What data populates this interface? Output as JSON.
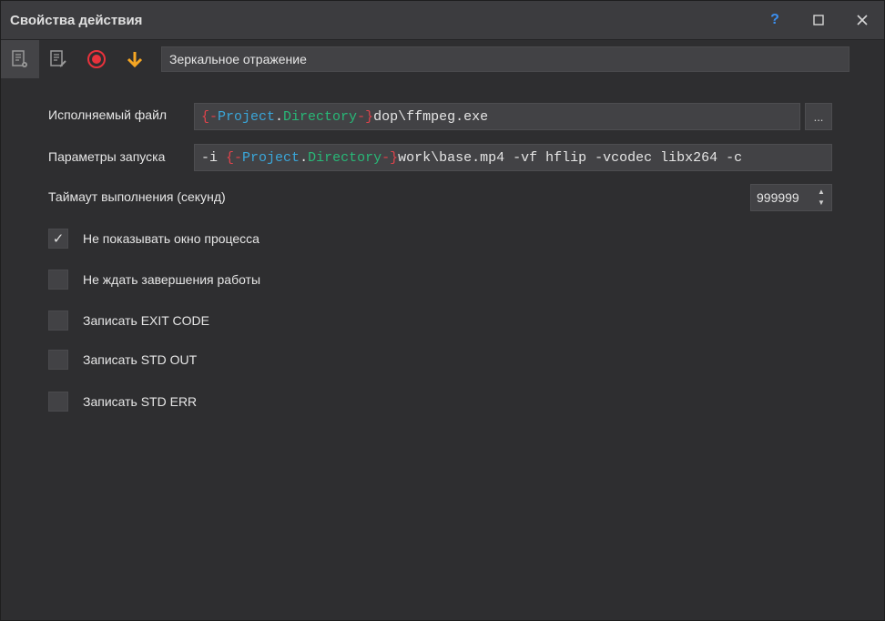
{
  "window": {
    "title": "Свойства действия",
    "help_label": "?"
  },
  "toolbar": {
    "action_name": "Зеркальное отражение"
  },
  "form": {
    "exe_label": "Исполняемый файл",
    "exe": {
      "brace_open": "{-",
      "project": "Project",
      "dot": ".",
      "directory": "Directory",
      "brace_close": "-}",
      "rest": "dop\\ffmpeg.exe"
    },
    "browse_label": "...",
    "params_label": "Параметры запуска",
    "params": {
      "prefix": "-i ",
      "brace_open": "{-",
      "project": "Project",
      "dot": ".",
      "directory": "Directory",
      "brace_close": "-}",
      "rest": "work\\base.mp4 -vf hflip -vcodec libx264 -c"
    },
    "timeout_label": "Таймаут выполнения (секунд)",
    "timeout_value": "999999"
  },
  "checkboxes": [
    {
      "label": "Не показывать окно процесса",
      "checked": true,
      "mark": "✓"
    },
    {
      "label": "Не ждать завершения работы",
      "checked": false,
      "mark": ""
    },
    {
      "label": "Записать EXIT CODE",
      "checked": false,
      "mark": ""
    },
    {
      "label": "Записать STD OUT",
      "checked": false,
      "mark": ""
    },
    {
      "label": "Записать STD ERR",
      "checked": false,
      "mark": ""
    }
  ],
  "colors": {
    "accent_blue": "#3b8ff0",
    "record_red": "#e8323c",
    "arrow_orange": "#f5a623",
    "var_brace": "#e0434b",
    "var_project": "#3aa6d9",
    "var_directory": "#28b877"
  }
}
